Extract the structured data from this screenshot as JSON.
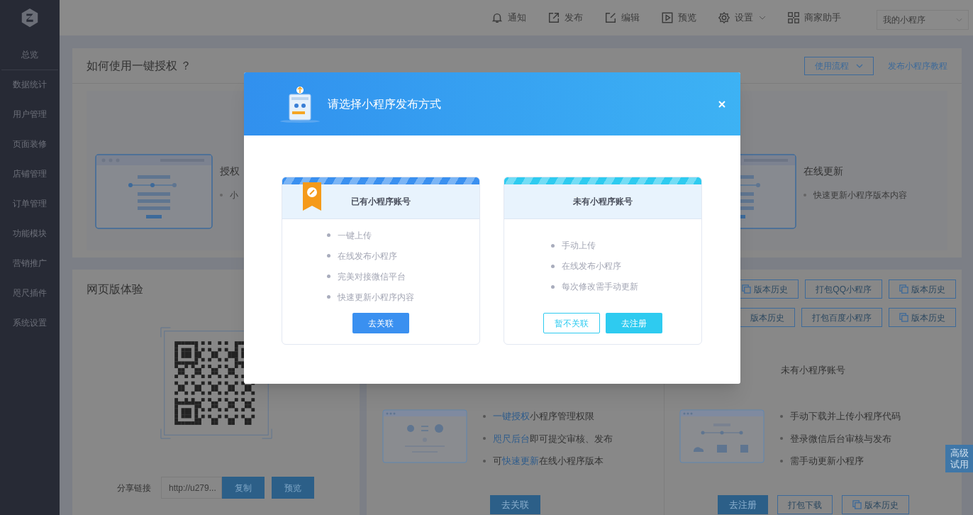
{
  "sidebar": {
    "items": [
      {
        "label": "总览",
        "selected": true
      },
      {
        "label": "数据统计",
        "selected": false
      },
      {
        "label": "用户管理",
        "selected": false
      },
      {
        "label": "页面装修",
        "selected": false
      },
      {
        "label": "店铺管理",
        "selected": false
      },
      {
        "label": "订单管理",
        "selected": false
      },
      {
        "label": "功能模块",
        "selected": false
      },
      {
        "label": "营销推广",
        "selected": false
      },
      {
        "label": "咫尺插件",
        "selected": false
      },
      {
        "label": "系统设置",
        "selected": false
      }
    ]
  },
  "topbar": {
    "items": [
      {
        "label": "通知",
        "caret": false
      },
      {
        "label": "发布",
        "caret": false
      },
      {
        "label": "编辑",
        "caret": false
      },
      {
        "label": "预览",
        "caret": false
      },
      {
        "label": "设置",
        "caret": true
      },
      {
        "label": "商家助手",
        "caret": false
      }
    ],
    "app_select": {
      "value": "我的小程序"
    }
  },
  "guide": {
    "title": "如何使用一键授权 ？",
    "flow_button": "使用流程",
    "tutorial_link": "发布小程序教程",
    "steps": [
      {
        "title": "授权",
        "bullets": [
          "小"
        ]
      },
      {
        "title": "在线更新",
        "bullets": [
          "快速更新小程序版本内容"
        ]
      }
    ]
  },
  "web_preview": {
    "title": "网页版体验",
    "share_label": "分享链接",
    "share_url": "http://u279...",
    "copy_button": "复制",
    "preview_button": "预览"
  },
  "publish": {
    "button_rows": [
      [
        {
          "label": "版本历史",
          "kind": "history"
        },
        {
          "label": "打包QQ小程序",
          "kind": "pack"
        },
        {
          "label": "版本历史",
          "kind": "history"
        }
      ],
      [
        {
          "label": "版本历史",
          "kind": "plain"
        },
        {
          "label": "打包百度小程序",
          "kind": "pack"
        },
        {
          "label": "版本历史",
          "kind": "history"
        }
      ]
    ],
    "columns": [
      {
        "bullets": [
          [
            {
              "text": "一键授权",
              "link": true
            },
            {
              "text": "小程序管理权限",
              "link": false
            }
          ],
          [
            {
              "text": "咫尺后台",
              "link": true
            },
            {
              "text": "即可提交审核、发布",
              "link": false
            }
          ],
          [
            {
              "text": "可",
              "link": false
            },
            {
              "text": "快速更新",
              "link": true
            },
            {
              "text": "在线小程序版本",
              "link": false
            }
          ]
        ],
        "buttons": [
          {
            "label": "去关联",
            "kind": "primary"
          }
        ]
      },
      {
        "heading": "未有小程序账号",
        "bullets": [
          [
            {
              "text": "手动下载并上传小程序代码",
              "link": false
            }
          ],
          [
            {
              "text": "登录微信后台审核与发布",
              "link": false
            }
          ],
          [
            {
              "text": "需手动更新小程序",
              "link": false
            }
          ]
        ],
        "buttons": [
          {
            "label": "去注册",
            "kind": "primary"
          },
          {
            "label": "打包下载",
            "kind": "pack"
          },
          {
            "label": "版本历史",
            "kind": "history"
          }
        ]
      }
    ]
  },
  "trial_tab": "高级试用",
  "dialog": {
    "title": "请选择小程序发布方式",
    "options": [
      {
        "title": "已有小程序账号",
        "ribbon": true,
        "color": "#3a90f0",
        "bullets": [
          "一键上传",
          "在线发布小程序",
          "完美对接微信平台",
          "快速更新小程序内容"
        ],
        "buttons": [
          {
            "label": "去关联",
            "kind": "primary"
          }
        ]
      },
      {
        "title": "未有小程序账号",
        "ribbon": false,
        "color": "#2ecbf0",
        "bullets": [
          "手动上传",
          "在线发布小程序",
          "每次修改需手动更新"
        ],
        "buttons": [
          {
            "label": "暂不关联",
            "kind": "outline"
          },
          {
            "label": "去注册",
            "kind": "primary"
          }
        ]
      }
    ]
  }
}
